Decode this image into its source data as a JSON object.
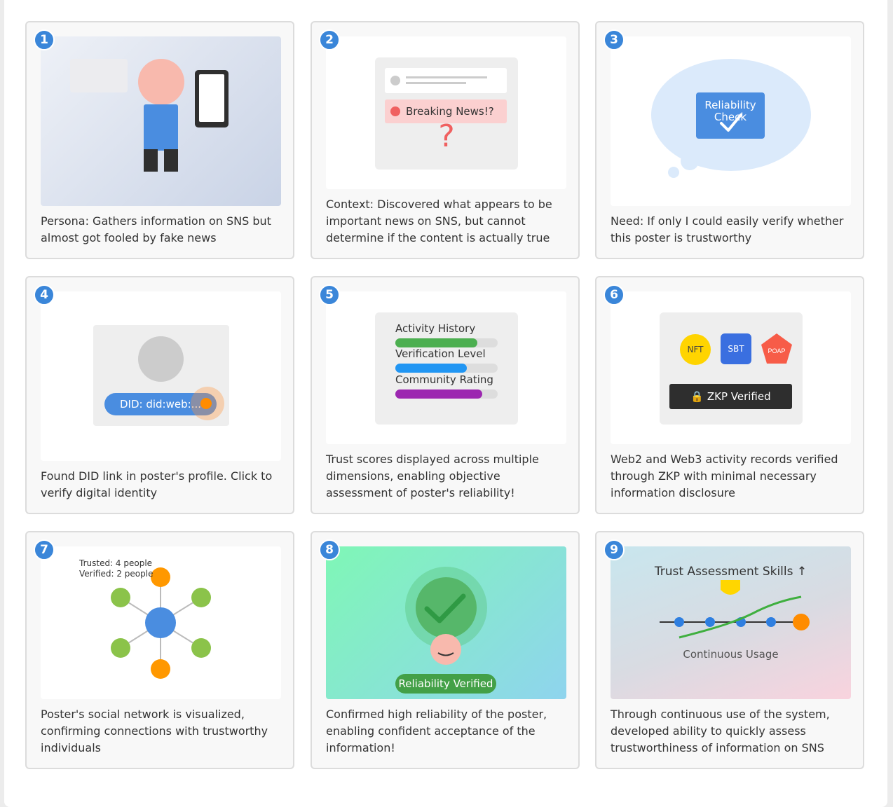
{
  "panels": [
    {
      "number": "1",
      "caption": "Persona: Gathers information on SNS but almost got fooled by fake news"
    },
    {
      "number": "2",
      "caption": "Context: Discovered what appears to be important news on SNS, but cannot determine if the content is actually true",
      "badge": "Breaking News!?",
      "mark": "?"
    },
    {
      "number": "3",
      "caption": "Need: If only I could easily verify whether this poster is trustworthy",
      "bubble_text_1": "Reliability",
      "bubble_text_2": "Check"
    },
    {
      "number": "4",
      "caption": "Found DID link in poster's profile. Click to verify digital identity",
      "did_label": "DID: did:web:..."
    },
    {
      "number": "5",
      "caption": "Trust scores displayed across multiple dimensions, enabling objective assessment of poster's reliability!",
      "bars": [
        {
          "label": "Activity History",
          "value": 0.8,
          "color": "#4caf50"
        },
        {
          "label": "Verification Level",
          "value": 0.7,
          "color": "#2196f3"
        },
        {
          "label": "Community Rating",
          "value": 0.85,
          "color": "#9c27b0"
        }
      ]
    },
    {
      "number": "6",
      "caption": "Web2 and Web3 activity records verified through ZKP with minimal necessary information disclosure",
      "tokens": [
        "NFT",
        "SBT",
        "POAP"
      ],
      "zkp_label": "ZKP Verified",
      "lock": "🔒"
    },
    {
      "number": "7",
      "caption": "Poster's social network is visualized, confirming connections with trustworthy individuals",
      "trusted": "Trusted: 4 people",
      "verified": "Verified: 2 people"
    },
    {
      "number": "8",
      "caption": "Confirmed high reliability of the poster, enabling confident acceptance of the information!",
      "verified_label": "Reliability Verified"
    },
    {
      "number": "9",
      "caption": "Through continuous use of the system, developed ability to quickly assess trustworthiness of information on SNS",
      "skills_title": "Trust Assessment Skills ↑",
      "usage_label": "Continuous Usage"
    }
  ],
  "colors": {
    "number_badge": "#3a86d9",
    "person_head": "#f8b9ad",
    "person_body": "#4a8de0",
    "alert_red": "#f06060",
    "green": "#4caf50",
    "orange": "#ff8c00",
    "lime": "#8bc34a"
  }
}
